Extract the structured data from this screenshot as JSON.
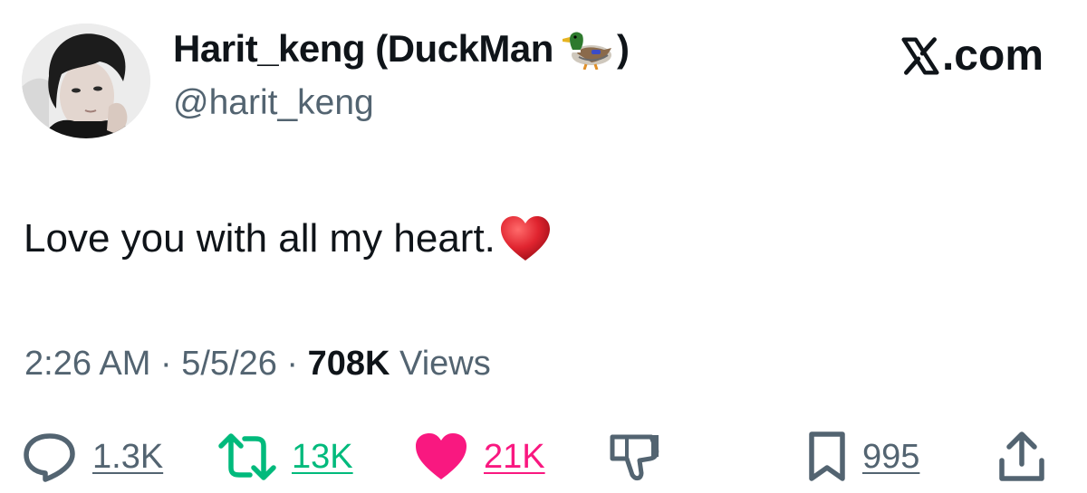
{
  "author": {
    "display_name": "Harit_keng (DuckMan",
    "display_name_suffix": ")",
    "name_emoji": "duck-emoji",
    "handle": "@harit_keng",
    "avatar": "profile-photo"
  },
  "brand": {
    "label": ".com",
    "logo_icon": "x-logo-icon"
  },
  "tweet": {
    "text": "Love you with all my heart.",
    "emoji": "red-heart-emoji",
    "time": "2:26 AM",
    "sep1": "·",
    "date": "5/5/26",
    "sep2": "·",
    "views_count": "708K",
    "views_label": "Views"
  },
  "actions": {
    "reply": {
      "icon": "reply-icon",
      "count": "1.3K",
      "color": "#536471"
    },
    "retweet": {
      "icon": "retweet-icon",
      "count": "13K",
      "color": "#00ba7c"
    },
    "like": {
      "icon": "heart-icon",
      "count": "21K",
      "color": "#f91880"
    },
    "dislike": {
      "icon": "thumbs-down-icon",
      "color": "#536471"
    },
    "bookmark": {
      "icon": "bookmark-icon",
      "count": "995",
      "color": "#536471"
    },
    "share": {
      "icon": "share-icon",
      "color": "#536471"
    }
  }
}
